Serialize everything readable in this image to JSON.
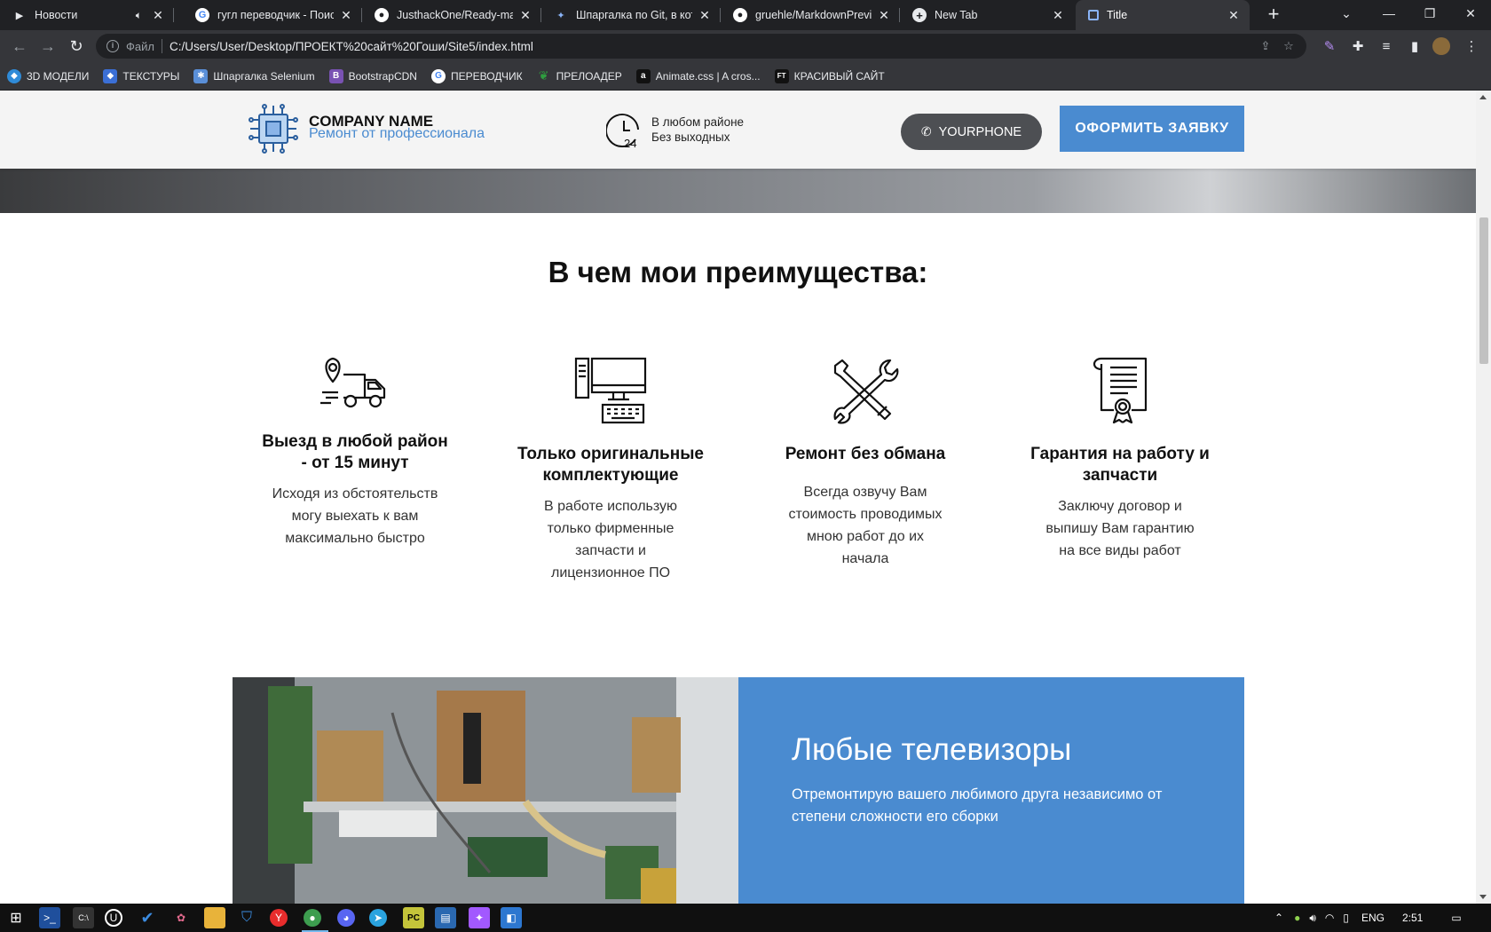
{
  "browser": {
    "tabs": [
      {
        "title": "Новости",
        "icon": "play-icon"
      },
      {
        "title": "гугл переводчик - Поиск",
        "icon": "google-icon"
      },
      {
        "title": "JusthackOne/Ready-made",
        "icon": "github-icon"
      },
      {
        "title": "Шпаргалка по Git, в кото",
        "icon": "bird-icon"
      },
      {
        "title": "gruehle/MarkdownPrevie",
        "icon": "github-icon"
      },
      {
        "title": "New Tab",
        "icon": "chrome-icon"
      },
      {
        "title": "Title",
        "icon": "page-icon"
      }
    ],
    "address": {
      "scheme": "Файл",
      "url": "C:/Users/User/Desktop/ПРОЕКТ%20сайт%20Гоши/Site5/index.html"
    },
    "bookmarks": [
      {
        "label": "3D МОДЕЛИ",
        "color": "#2f8bd8"
      },
      {
        "label": "ТЕКСТУРЫ",
        "color": "#3b6fd6"
      },
      {
        "label": "Шпаргалка Selenium",
        "color": "#5a8fd8"
      },
      {
        "label": "BootstrapCDN",
        "color": "#7952b3",
        "glyph": "B"
      },
      {
        "label": "ПЕРЕВОДЧИК",
        "color": "#ffffff",
        "glyph": "G"
      },
      {
        "label": "ПРЕЛОАДЕР",
        "color": "#2e9e3f"
      },
      {
        "label": "Animate.css | A cros...",
        "color": "#111111",
        "glyph": "a"
      },
      {
        "label": "КРАСИВЫЙ САЙТ",
        "color": "#111111",
        "glyph": "FT"
      }
    ]
  },
  "site": {
    "header": {
      "company": "COMPANY NAME",
      "tagline": "Ремонт от профессионала",
      "hours_line1": "В любом районе",
      "hours_line2": "Без выходных",
      "clock_number": "24",
      "phone_label": "YOURPHONE",
      "order_label": "ОФОРМИТЬ ЗАЯВКУ",
      "accent": "#4a8bd0"
    },
    "advantages": {
      "title": "В чем мои преимущества:",
      "items": [
        {
          "icon": "delivery-truck-icon",
          "title_line1": "Выезд в любой район",
          "title_line2": "- от 15 минут",
          "desc": [
            "Исходя из обстоятельств",
            "могу выехать к вам",
            "максимально быстро"
          ]
        },
        {
          "icon": "computer-icon",
          "title_line1": "Только оригинальные",
          "title_line2": "комплектующие",
          "desc": [
            "В работе использую",
            "только фирменные",
            "запчасти и",
            "лицензионное ПО"
          ]
        },
        {
          "icon": "tools-icon",
          "title_line1": "Ремонт без обмана",
          "title_line2": "",
          "desc": [
            "Всегда озвучу Вам",
            "стоимость проводимых",
            "мною работ до их",
            "начала"
          ]
        },
        {
          "icon": "certificate-icon",
          "title_line1": "Гарантия на работу и",
          "title_line2": "запчасти",
          "desc": [
            "Заключу договор и",
            "выпишу Вам гарантию",
            "на все виды работ"
          ]
        }
      ]
    },
    "tv_block": {
      "title": "Любые телевизоры",
      "desc": "Отремонтирую вашего любимого друга независимо от степени сложности его сборки"
    }
  },
  "taskbar": {
    "apps": [
      "windows-start-icon",
      "powershell-icon",
      "cmd-icon",
      "unreal-icon",
      "todo-icon",
      "paint-icon",
      "folder-icon",
      "defender-icon",
      "yandex-icon",
      "chrome-icon",
      "discord-icon",
      "telegram-icon",
      "pycharm-icon",
      "settings-icon",
      "figma-icon",
      "vscode-icon"
    ],
    "language": "ENG",
    "time": "2:51"
  }
}
